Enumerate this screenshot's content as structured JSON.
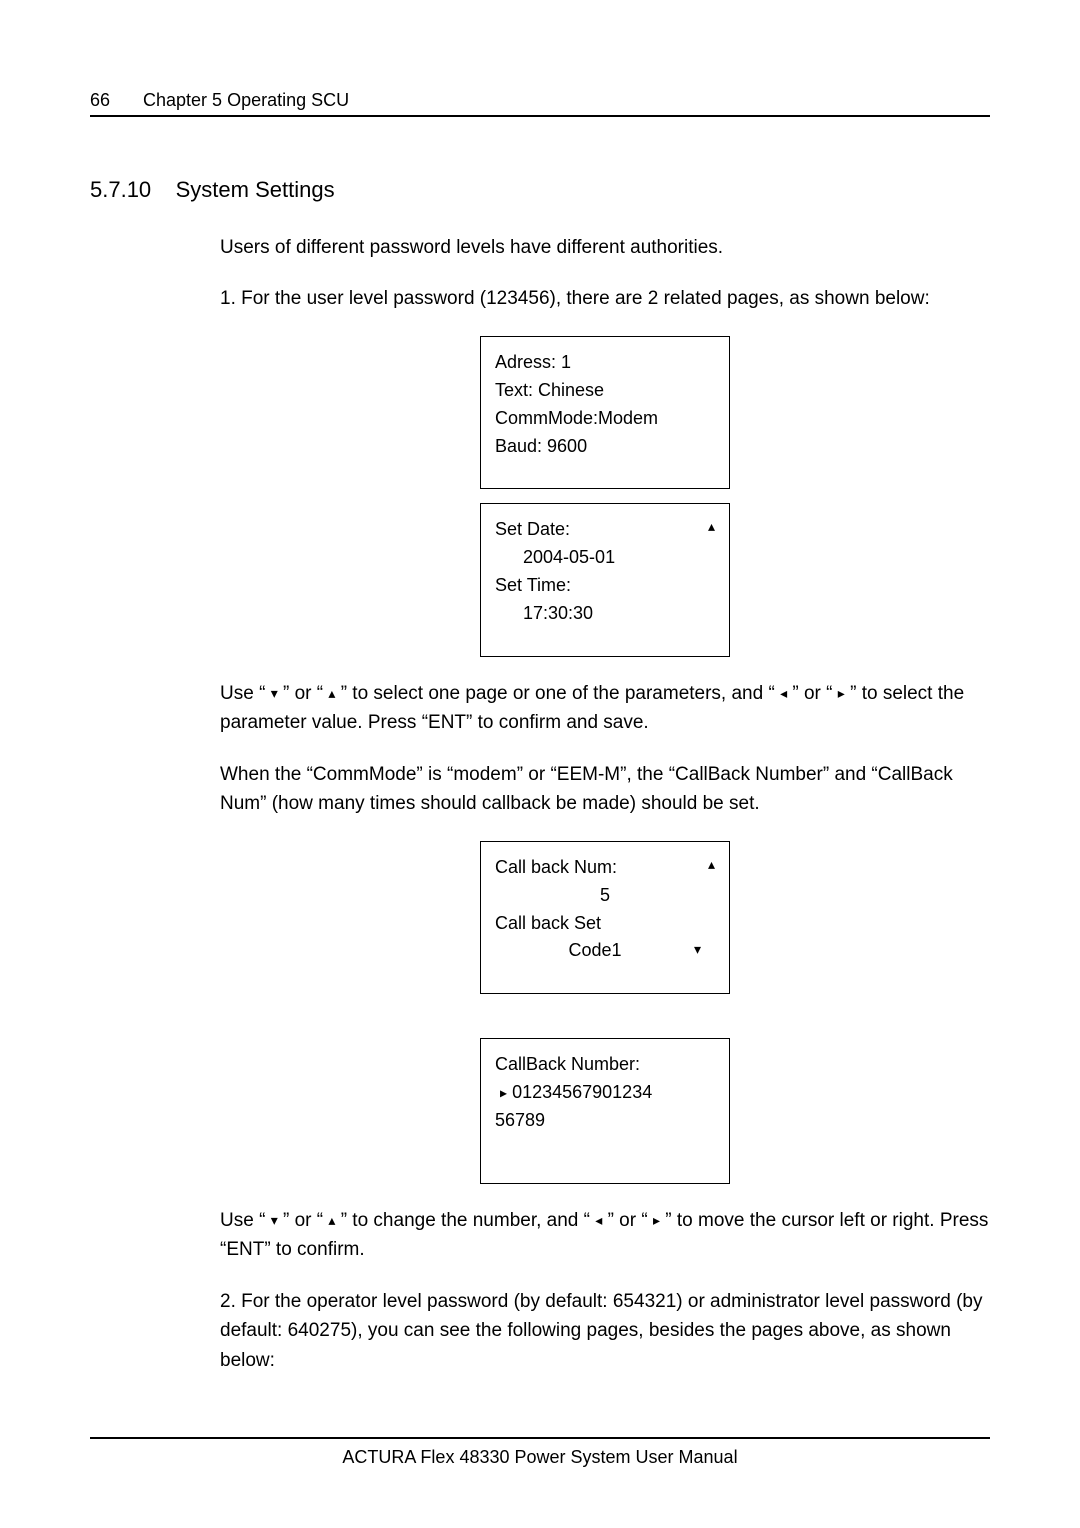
{
  "header": {
    "page_number": "66",
    "chapter": "Chapter 5   Operating SCU"
  },
  "section": {
    "number": "5.7.10",
    "title": "System Settings"
  },
  "paragraphs": {
    "intro": "Users of different password levels have different authorities.",
    "p1": "1. For the user level password (123456), there are 2 related pages, as shown below:",
    "use1_pre": "Use “ ",
    "use1_mid1": " ” or “ ",
    "use1_mid2": " ” to select one page or one of the parameters, and “ ",
    "use1_mid3": " ” or “ ",
    "use1_post": " ” to select the parameter value. Press “ENT” to confirm and save.",
    "p2": "When the “CommMode” is “modem” or “EEM-M”, the “CallBack Number” and “CallBack Num” (how many times should callback be made) should be set.",
    "use2_pre": "Use “ ",
    "use2_mid1": " ” or “ ",
    "use2_mid2": " ” to change the number, and “ ",
    "use2_mid3": " ” or “ ",
    "use2_post": " ” to move the cursor left or right. Press “ENT” to confirm.",
    "p3": "2. For the operator level password (by default: 654321) or administrator level password (by default: 640275), you can see the following pages, besides the pages above, as shown below:"
  },
  "arrows": {
    "down": "▾",
    "up": "▴",
    "left": "◂",
    "right": "▸",
    "up_solid": "▴",
    "down_solid": "▾",
    "right_solid": "▸"
  },
  "lcd1": {
    "l1": "Adress:    1",
    "l2": "Text: Chinese",
    "l3": "CommMode:Modem",
    "l4": "Baud: 9600"
  },
  "lcd2": {
    "l1": "Set Date:",
    "l2": "2004-05-01",
    "l3": "Set Time:",
    "l4": "17:30:30"
  },
  "lcd3": {
    "l1": "Call back Num:",
    "l2": "5",
    "l3": "Call back Set",
    "l4": "Code1"
  },
  "lcd4": {
    "l1": "CallBack Number:",
    "l2": "01234567901234",
    "l3": "56789"
  },
  "footer": {
    "text": "ACTURA Flex 48330 Power System    User Manual"
  }
}
